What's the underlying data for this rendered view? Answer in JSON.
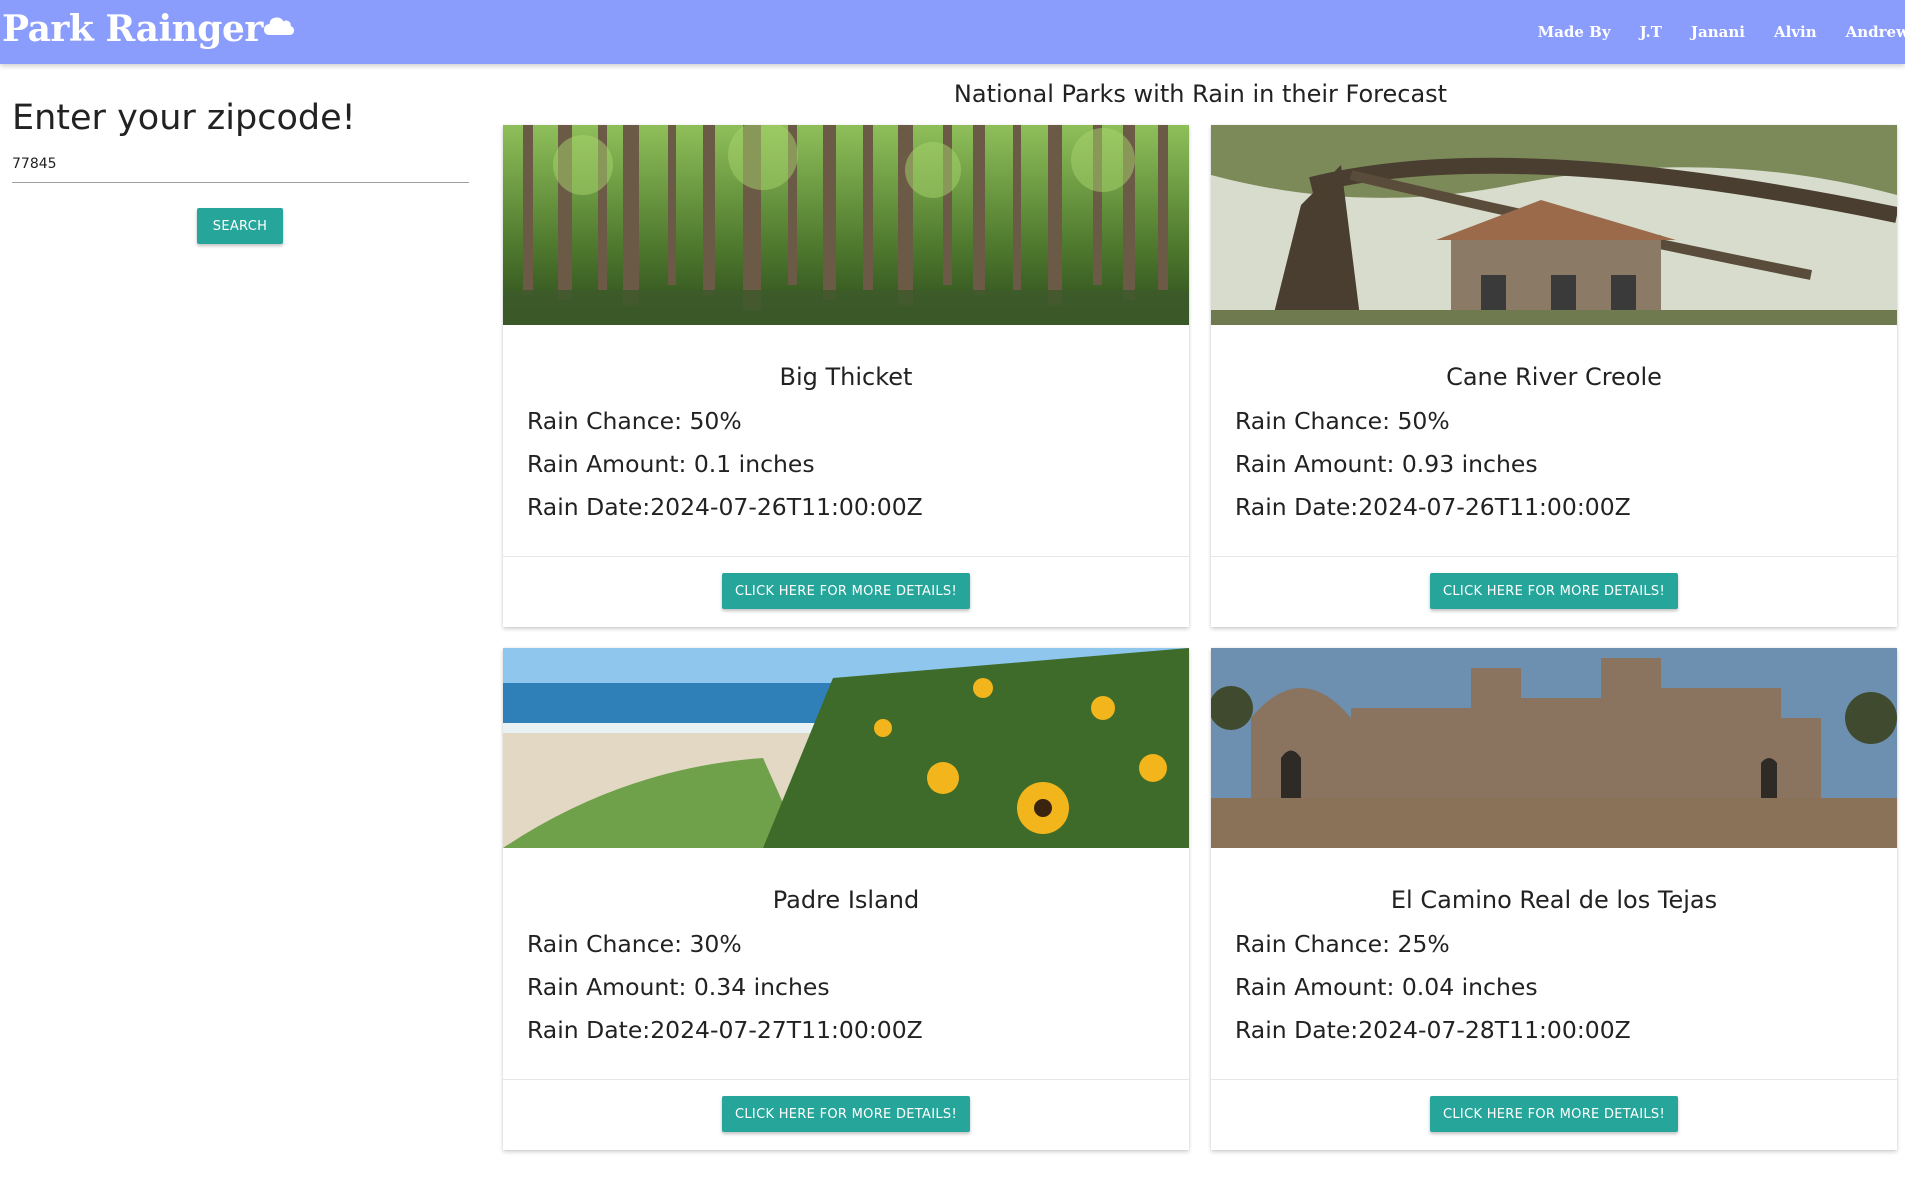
{
  "header": {
    "brand": "Park Rainger",
    "nav": [
      "Made By",
      "J.T",
      "Janani",
      "Alvin",
      "Andrew"
    ]
  },
  "search": {
    "heading": "Enter your zipcode!",
    "value": "77845",
    "button_label": "Search"
  },
  "main": {
    "title": "National Parks with Rain in their Forecast"
  },
  "parks": [
    {
      "name": "Big Thicket",
      "rain_chance": "Rain Chance: 50%",
      "rain_amount": "Rain Amount: 0.1 inches",
      "rain_date": "Rain Date:2024-07-26T11:00:00Z",
      "button_label": "Click here for more details!"
    },
    {
      "name": "Cane River Creole",
      "rain_chance": "Rain Chance: 50%",
      "rain_amount": "Rain Amount: 0.93 inches",
      "rain_date": "Rain Date:2024-07-26T11:00:00Z",
      "button_label": "Click here for more details!"
    },
    {
      "name": "Padre Island",
      "rain_chance": "Rain Chance: 30%",
      "rain_amount": "Rain Amount: 0.34 inches",
      "rain_date": "Rain Date:2024-07-27T11:00:00Z",
      "button_label": "Click here for more details!"
    },
    {
      "name": "El Camino Real de los Tejas",
      "rain_chance": "Rain Chance: 25%",
      "rain_amount": "Rain Amount: 0.04 inches",
      "rain_date": "Rain Date:2024-07-28T11:00:00Z",
      "button_label": "Click here for more details!"
    }
  ],
  "colors": {
    "navbar": "#8b9dfc",
    "button": "#26a69a"
  }
}
